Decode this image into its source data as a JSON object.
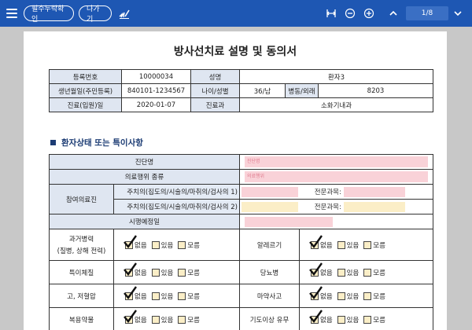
{
  "toolbar": {
    "btn_required": "필수누락확인",
    "btn_exit": "나가기",
    "page_indicator": "1/8"
  },
  "document": {
    "title": "방사선치료 설명 및 동의서",
    "patient": {
      "reg_no_label": "등록번호",
      "reg_no": "10000034",
      "name_label": "성명",
      "name": "환자3",
      "birth_label": "생년월일(주민등록)",
      "birth": "840101-1234567",
      "agesex_label": "나이/성별",
      "agesex": "36/남",
      "ward_label": "병동/외래",
      "ward": "8203",
      "visit_label": "진료(입원)일",
      "visit": "2020-01-07",
      "dept_label": "진료과",
      "dept": "소화기내과"
    },
    "section_title": "환자상태 또는 특이사항",
    "status": {
      "diagnosis_label": "진단명",
      "diagnosis_placeholder": "진단명",
      "procedure_label": "의료행위 종류",
      "procedure_placeholder": "의료행위",
      "participants_label": "참여의료진",
      "primary1_label": "주치의(집도의/시술의/마취의/검사의 1)",
      "primary2_label": "주치의(집도의/시술의/마취의/검사의 2)",
      "specialty_label": "전문과목:",
      "schedule_label": "시행예정일",
      "opt_none": "없음",
      "opt_yes": "있음",
      "opt_unknown": "모름",
      "rows": [
        {
          "left_label": "과거병력",
          "left_sub": "(질병, 상해 전력)",
          "right_label": "알레르기"
        },
        {
          "left_label": "특이체질",
          "left_sub": "",
          "right_label": "당뇨병"
        },
        {
          "left_label": "고, 저혈압",
          "left_sub": "",
          "right_label": "마약사고"
        },
        {
          "left_label": "복용약물",
          "left_sub": "",
          "right_label": "기도이상 유무"
        }
      ]
    }
  }
}
